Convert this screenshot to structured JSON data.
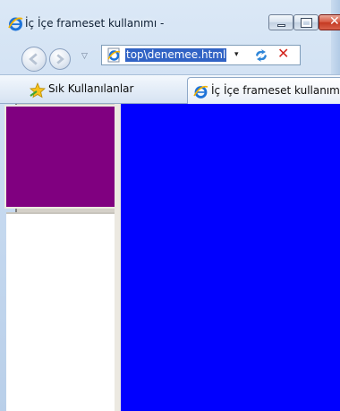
{
  "window": {
    "title": "İç İçe frameset kullanımı -",
    "accent_color": "#3163c5"
  },
  "caption_buttons": {
    "minimize_icon": "minimize-icon",
    "maximize_icon": "maximize-icon",
    "close_glyph": "✕"
  },
  "navigation": {
    "back_icon": "back-arrow-icon",
    "forward_icon": "forward-arrow-icon",
    "dropdown_glyph": "▽",
    "address_value": "top\\denemee.html",
    "address_dropdown_glyph": "▾",
    "refresh_icon": "refresh-icon",
    "stop_glyph": "✕"
  },
  "favorites": {
    "label": "Sık Kullanılanlar",
    "icon": "favorites-star-icon"
  },
  "tab": {
    "label": "İç İçe frameset kullanımı",
    "icon": "ie-page-icon"
  },
  "frames": {
    "left_top_color": "#800080",
    "left_bottom_color": "#ffffff",
    "right_color": "#0000ff"
  }
}
